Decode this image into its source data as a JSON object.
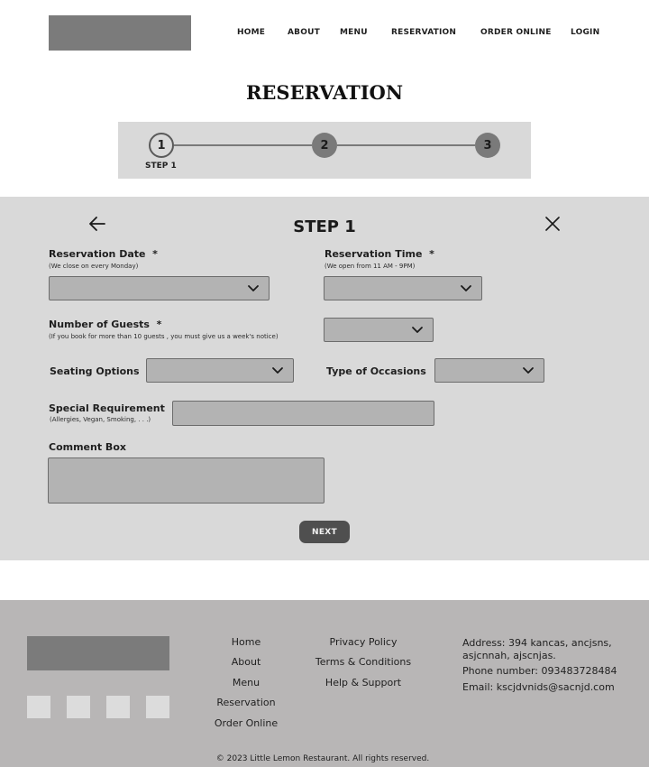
{
  "nav": {
    "home": "HOME",
    "about": "ABOUT",
    "menu": "MENU",
    "reservation": "RESERVATION",
    "order_online": "ORDER ONLINE",
    "login": "LOGIN"
  },
  "page_title": "RESERVATION",
  "stepper": {
    "steps": [
      "1",
      "2",
      "3"
    ],
    "current_caption": "STEP 1"
  },
  "form": {
    "title": "STEP 1",
    "reservation_date": {
      "label": "Reservation Date",
      "required": "*",
      "hint": "(We close on every Monday)",
      "value": ""
    },
    "reservation_time": {
      "label": "Reservation Time",
      "required": "*",
      "hint": "(We open from 11 AM - 9PM)",
      "value": ""
    },
    "guests": {
      "label": "Number of Guests",
      "required": "*",
      "hint": "(If you book for more than 10 guests , you must give us a week's notice)",
      "value": ""
    },
    "seating": {
      "label": "Seating Options",
      "value": ""
    },
    "occasion": {
      "label": "Type of Occasions",
      "value": ""
    },
    "special": {
      "label": "Special Requirement",
      "hint": "(Allergies, Vegan, Smoking, . . .)",
      "value": ""
    },
    "comment": {
      "label": "Comment Box",
      "value": ""
    },
    "next_label": "NEXT"
  },
  "footer": {
    "links_col1": [
      "Home",
      "About",
      "Menu",
      "Reservation",
      "Order Online"
    ],
    "links_col2": [
      "Privacy Policy",
      "Terms & Conditions",
      "Help & Support"
    ],
    "address": "Address: 394 kancas, ancjsns, asjcnnah, ajscnjas.",
    "phone": "Phone number: 093483728484",
    "email": "Email: kscjdvnids@sacnjd.com",
    "copyright": "© 2023 Little Lemon Restaurant. All rights reserved."
  },
  "colors": {
    "panel": "#d9d9d9",
    "field": "#b3b3b3",
    "logo_placeholder": "#7b7b7b",
    "footer": "#b8b6b6",
    "button": "#4f4f4f"
  }
}
